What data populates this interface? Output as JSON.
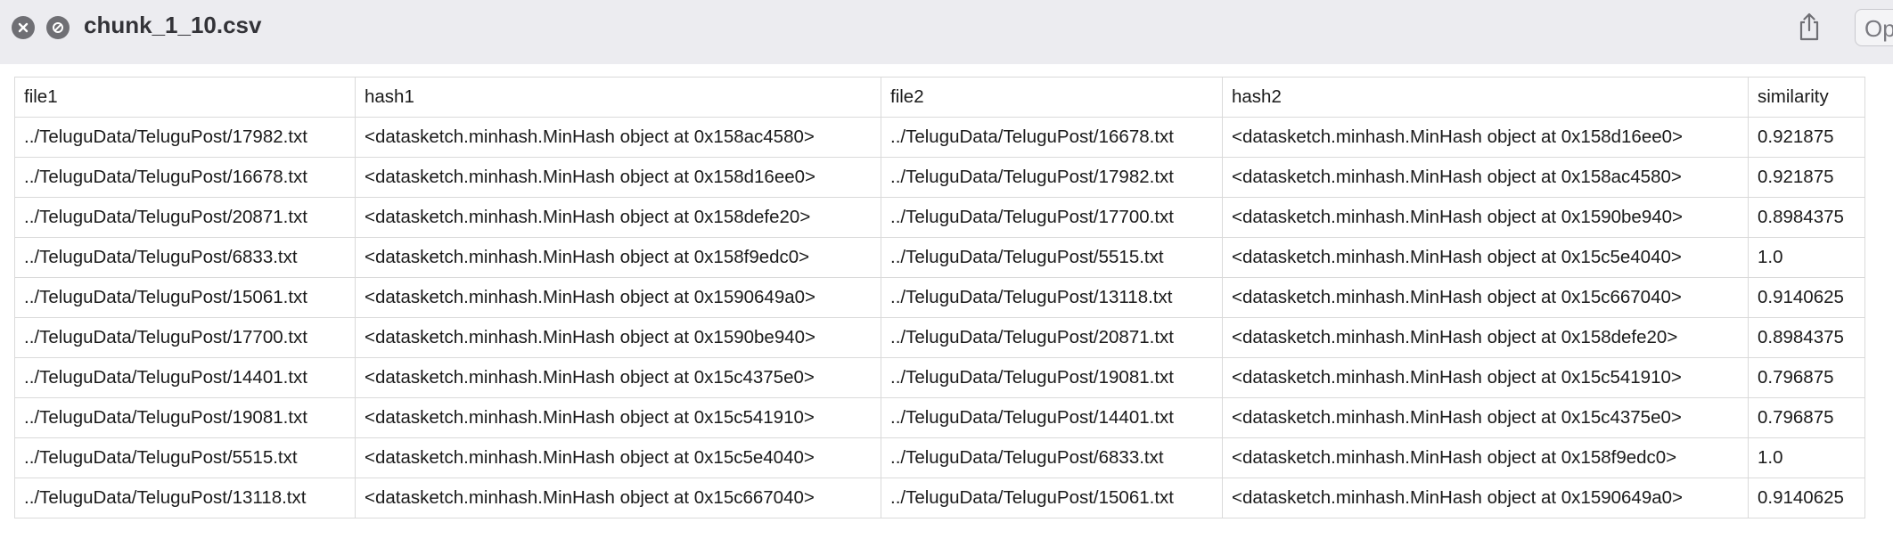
{
  "window": {
    "title": "chunk_1_10.csv",
    "open_label": "Op"
  },
  "icons": {
    "close": "close-circle-icon",
    "block": "block-circle-icon",
    "share": "share-icon"
  },
  "colors": {
    "titlebar_bg": "#ececf0",
    "grid_line": "#dadada",
    "icon_gray": "#6f6f74"
  },
  "table": {
    "columns": [
      "file1",
      "hash1",
      "file2",
      "hash2",
      "similarity"
    ],
    "rows": [
      [
        "../TeluguData/TeluguPost/17982.txt",
        "<datasketch.minhash.MinHash object at 0x158ac4580>",
        "../TeluguData/TeluguPost/16678.txt",
        "<datasketch.minhash.MinHash object at 0x158d16ee0>",
        "0.921875"
      ],
      [
        "../TeluguData/TeluguPost/16678.txt",
        "<datasketch.minhash.MinHash object at 0x158d16ee0>",
        "../TeluguData/TeluguPost/17982.txt",
        "<datasketch.minhash.MinHash object at 0x158ac4580>",
        "0.921875"
      ],
      [
        "../TeluguData/TeluguPost/20871.txt",
        "<datasketch.minhash.MinHash object at 0x158defe20>",
        "../TeluguData/TeluguPost/17700.txt",
        "<datasketch.minhash.MinHash object at 0x1590be940>",
        "0.8984375"
      ],
      [
        "../TeluguData/TeluguPost/6833.txt",
        "<datasketch.minhash.MinHash object at 0x158f9edc0>",
        "../TeluguData/TeluguPost/5515.txt",
        "<datasketch.minhash.MinHash object at 0x15c5e4040>",
        "1.0"
      ],
      [
        "../TeluguData/TeluguPost/15061.txt",
        "<datasketch.minhash.MinHash object at 0x1590649a0>",
        "../TeluguData/TeluguPost/13118.txt",
        "<datasketch.minhash.MinHash object at 0x15c667040>",
        "0.9140625"
      ],
      [
        "../TeluguData/TeluguPost/17700.txt",
        "<datasketch.minhash.MinHash object at 0x1590be940>",
        "../TeluguData/TeluguPost/20871.txt",
        "<datasketch.minhash.MinHash object at 0x158defe20>",
        "0.8984375"
      ],
      [
        "../TeluguData/TeluguPost/14401.txt",
        "<datasketch.minhash.MinHash object at 0x15c4375e0>",
        "../TeluguData/TeluguPost/19081.txt",
        "<datasketch.minhash.MinHash object at 0x15c541910>",
        "0.796875"
      ],
      [
        "../TeluguData/TeluguPost/19081.txt",
        "<datasketch.minhash.MinHash object at 0x15c541910>",
        "../TeluguData/TeluguPost/14401.txt",
        "<datasketch.minhash.MinHash object at 0x15c4375e0>",
        "0.796875"
      ],
      [
        "../TeluguData/TeluguPost/5515.txt",
        "<datasketch.minhash.MinHash object at 0x15c5e4040>",
        "../TeluguData/TeluguPost/6833.txt",
        "<datasketch.minhash.MinHash object at 0x158f9edc0>",
        "1.0"
      ],
      [
        "../TeluguData/TeluguPost/13118.txt",
        "<datasketch.minhash.MinHash object at 0x15c667040>",
        "../TeluguData/TeluguPost/15061.txt",
        "<datasketch.minhash.MinHash object at 0x1590649a0>",
        "0.9140625"
      ]
    ]
  }
}
